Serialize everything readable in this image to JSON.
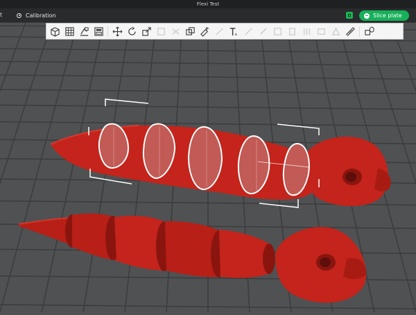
{
  "window": {
    "title": "Flexi Test"
  },
  "tabs": {
    "left_fragment": "t",
    "calibration_label": "Calibration"
  },
  "header": {
    "slice_button_label": "Slice plate"
  },
  "toolbar": {
    "tools": [
      {
        "icon": "add-cube-icon",
        "state": "active"
      },
      {
        "icon": "grid-arrange-icon",
        "state": "active"
      },
      {
        "icon": "orient-icon",
        "state": "active"
      },
      {
        "icon": "plate-layout-icon",
        "state": "active"
      },
      {
        "icon": "divider",
        "state": "none"
      },
      {
        "icon": "move-icon",
        "state": "active"
      },
      {
        "icon": "rotate-icon",
        "state": "active"
      },
      {
        "icon": "scale-icon",
        "state": "active"
      },
      {
        "icon": "lay-on-face-icon",
        "state": "faded"
      },
      {
        "icon": "cut-icon",
        "state": "faded"
      },
      {
        "icon": "boolean-icon",
        "state": "active"
      },
      {
        "icon": "paint-support-icon",
        "state": "active"
      },
      {
        "icon": "seam-icon",
        "state": "faded"
      },
      {
        "icon": "text-emboss-icon",
        "state": "active"
      },
      {
        "icon": "measure-faded-icon",
        "state": "faded"
      },
      {
        "icon": "color-paint-icon",
        "state": "faded"
      },
      {
        "icon": "variable-height-icon",
        "state": "faded"
      },
      {
        "icon": "fuzzy-skin-icon",
        "state": "faded"
      },
      {
        "icon": "brim-ears-icon",
        "state": "faded"
      },
      {
        "icon": "support-blocker-icon",
        "state": "faded"
      },
      {
        "icon": "assembly-icon",
        "state": "faded"
      },
      {
        "icon": "measure-ruler-icon",
        "state": "active"
      },
      {
        "icon": "divider",
        "state": "none"
      },
      {
        "icon": "assembly-view-icon",
        "state": "active"
      }
    ]
  },
  "colors": {
    "plate": "#505254",
    "grid": "#383a3c",
    "model_red": "#b81f17",
    "model_red_dark": "#8a150f",
    "accent_green": "#17b05a"
  }
}
